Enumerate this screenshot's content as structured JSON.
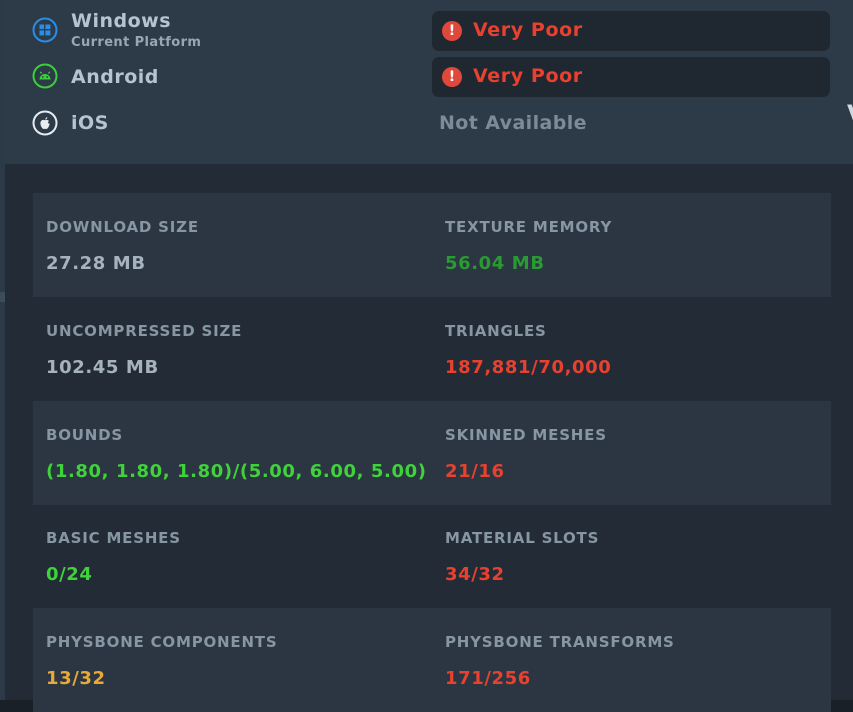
{
  "colors": {
    "neutral": "#a6b3bf",
    "good": "#2a9a32",
    "excellent": "#3fd23a",
    "poor": "#e8412f",
    "medium": "#e6a93a",
    "windows_icon": "#2a8ee6",
    "android_icon": "#3ccf3c",
    "ios_icon": "#e6ecf2"
  },
  "platforms": [
    {
      "name": "Windows",
      "subtitle": "Current Platform",
      "icon": "windows-icon",
      "rating": "Very Poor",
      "rating_icon": "warning-icon"
    },
    {
      "name": "Android",
      "subtitle": "",
      "icon": "android-icon",
      "rating": "Very Poor",
      "rating_icon": "warning-icon"
    },
    {
      "name": "iOS",
      "subtitle": "",
      "icon": "apple-icon",
      "rating": "Not Available",
      "rating_icon": ""
    }
  ],
  "stats": [
    {
      "label": "DOWNLOAD SIZE",
      "value": "27.28 MB",
      "color": "#a6b3bf"
    },
    {
      "label": "TEXTURE MEMORY",
      "value": "56.04 MB",
      "color": "#2a9a32"
    },
    {
      "label": "UNCOMPRESSED SIZE",
      "value": "102.45 MB",
      "color": "#a6b3bf"
    },
    {
      "label": "TRIANGLES",
      "value": "187,881/70,000",
      "color": "#e8412f"
    },
    {
      "label": "BOUNDS",
      "value": "(1.80, 1.80, 1.80)/(5.00, 6.00, 5.00)",
      "color": "#3fd23a"
    },
    {
      "label": "SKINNED MESHES",
      "value": "21/16",
      "color": "#e8412f"
    },
    {
      "label": "BASIC MESHES",
      "value": "0/24",
      "color": "#3fd23a"
    },
    {
      "label": "MATERIAL SLOTS",
      "value": "34/32",
      "color": "#e8412f"
    },
    {
      "label": "PHYSBONE COMPONENTS",
      "value": "13/32",
      "color": "#e6a93a"
    },
    {
      "label": "PHYSBONE TRANSFORMS",
      "value": "171/256",
      "color": "#e8412f"
    }
  ]
}
